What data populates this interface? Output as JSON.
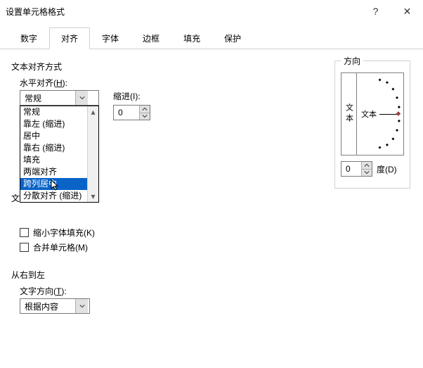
{
  "title": "设置单元格格式",
  "titlebar": {
    "help": "?",
    "close": "✕"
  },
  "tabs": {
    "items": [
      {
        "label": "数字"
      },
      {
        "label": "对齐"
      },
      {
        "label": "字体"
      },
      {
        "label": "边框"
      },
      {
        "label": "填充"
      },
      {
        "label": "保护"
      }
    ],
    "active_index": 1
  },
  "text_alignment": {
    "section_label": "文本对齐方式",
    "horizontal": {
      "label_pre": "水平对齐(",
      "label_key": "H",
      "label_post": "):",
      "value": "常规",
      "options": [
        "常规",
        "靠左 (缩进)",
        "居中",
        "靠右 (缩进)",
        "填充",
        "两端对齐",
        "跨列居中",
        "分散对齐 (缩进)"
      ],
      "highlighted_index": 6
    },
    "indent": {
      "label_pre": "缩进(",
      "label_key": "I",
      "label_post": "):",
      "value": "0"
    },
    "text_control_label_pre": "文",
    "shrink": {
      "label_pre": "缩小字体填充(",
      "label_key": "K",
      "label_post": ")"
    },
    "merge": {
      "label_pre": "合并单元格(",
      "label_key": "M",
      "label_post": ")"
    }
  },
  "rtl": {
    "section_label": "从右到左",
    "direction": {
      "label_pre": "文字方向(",
      "label_key": "T",
      "label_post": "):",
      "value": "根据内容"
    }
  },
  "orientation": {
    "legend": "方向",
    "vertical_text": "文本",
    "dial_label": "文本",
    "degree_value": "0",
    "degree_label_pre": "度(",
    "degree_label_key": "D",
    "degree_label_post": ")"
  }
}
